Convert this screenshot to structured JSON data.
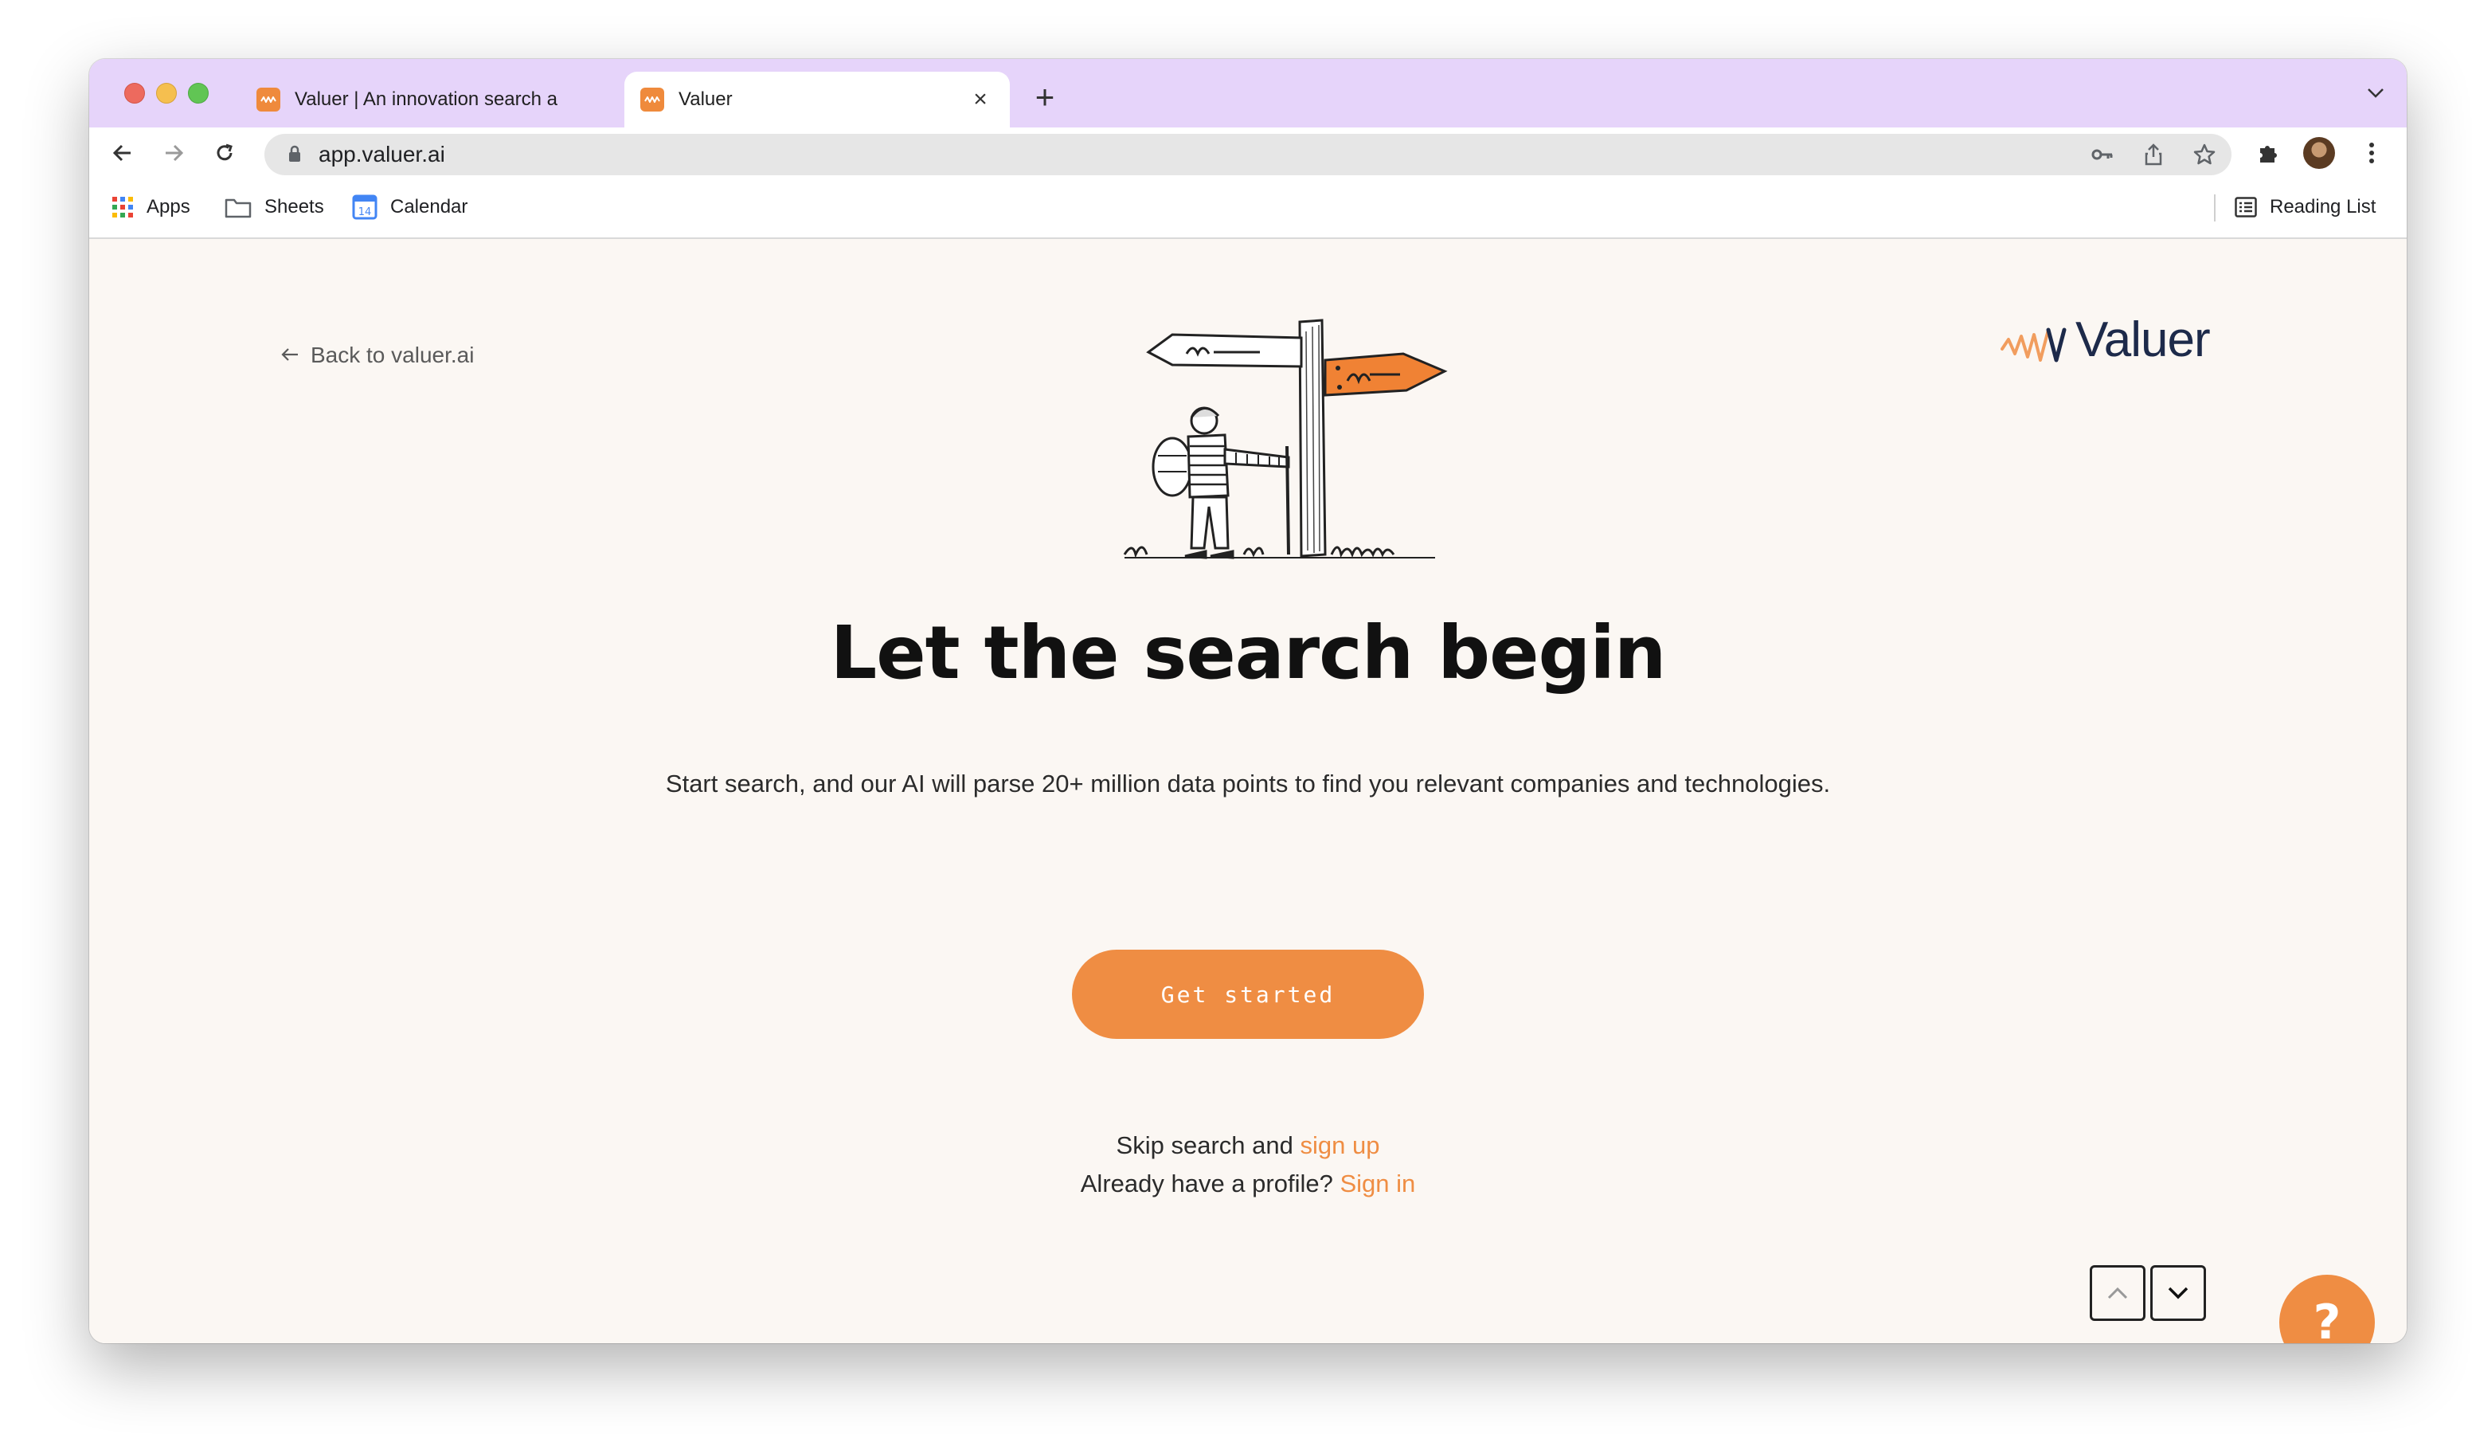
{
  "browser": {
    "tabs": [
      {
        "title": "Valuer | An innovation search a",
        "active": false
      },
      {
        "title": "Valuer",
        "active": true
      }
    ],
    "url": "app.valuer.ai",
    "bookmarks": [
      {
        "label": "Apps",
        "icon": "apps-grid-icon"
      },
      {
        "label": "Sheets",
        "icon": "folder-icon"
      },
      {
        "label": "Calendar",
        "icon": "calendar-icon",
        "badge": "14"
      }
    ],
    "reading_list": "Reading List"
  },
  "page": {
    "back_link": "Back to valuer.ai",
    "brand": "Valuer",
    "headline": "Let the search begin",
    "subtext": "Start search, and our AI will parse 20+ million data points to find you relevant companies and technologies.",
    "cta": "Get started",
    "skip_prefix": "Skip search and ",
    "skip_link": "sign up",
    "signin_prefix": "Already have a profile? ",
    "signin_link": "Sign in",
    "help_label": "?"
  },
  "colors": {
    "accent": "#ef8d43",
    "tabstrip": "#e6d4fa",
    "background": "#fbf7f3",
    "brand_text": "#1d2a4a"
  }
}
